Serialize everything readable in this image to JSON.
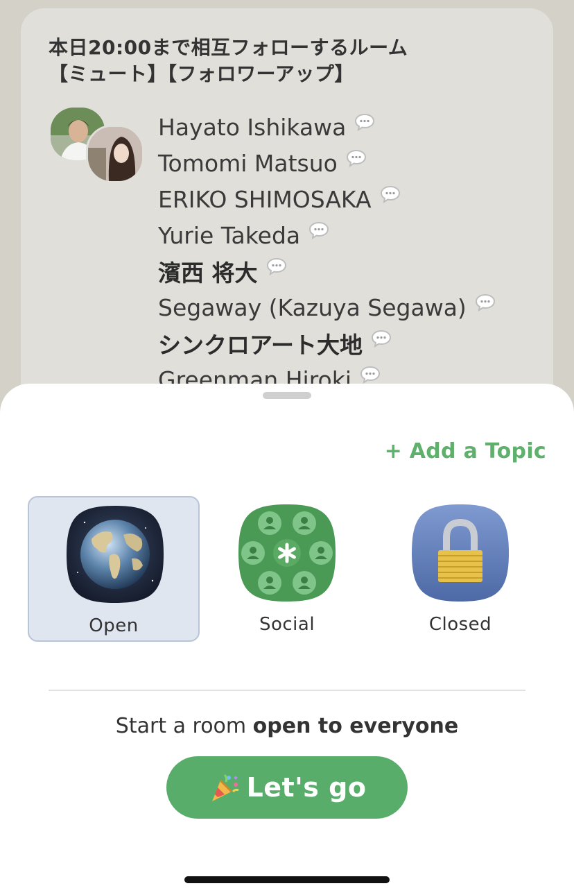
{
  "room": {
    "title_line1": "本日20:00まで相互フォローするルーム",
    "title_line2": "【ミュート】【フォロワーアップ】",
    "speakers": [
      {
        "name": "Hayato Ishikawa",
        "bold": false
      },
      {
        "name": "Tomomi Matsuo",
        "bold": false
      },
      {
        "name": "ERIKO SHIMOSAKA",
        "bold": false
      },
      {
        "name": "Yurie Takeda",
        "bold": false
      },
      {
        "name": "濱西 将大",
        "bold": true
      },
      {
        "name": "Segaway (Kazuya Segawa)",
        "bold": false
      },
      {
        "name": "シンクロアート大地",
        "bold": true
      },
      {
        "name": "Greenman Hiroki",
        "bold": false
      }
    ]
  },
  "sheet": {
    "add_topic": "+ Add a Topic",
    "options": {
      "open": {
        "label": "Open",
        "icon": "globe-icon"
      },
      "social": {
        "label": "Social",
        "icon": "people-circle-icon"
      },
      "closed": {
        "label": "Closed",
        "icon": "lock-icon"
      }
    },
    "selected_option": "open",
    "hint_prefix": "Start a room ",
    "hint_bold": "open to everyone",
    "go_label": "Let's go",
    "go_icon": "party-popper-icon"
  },
  "colors": {
    "accent_green": "#58ad6a",
    "topic_green": "#5fb06c",
    "selected_bg": "#e0e6f0"
  }
}
